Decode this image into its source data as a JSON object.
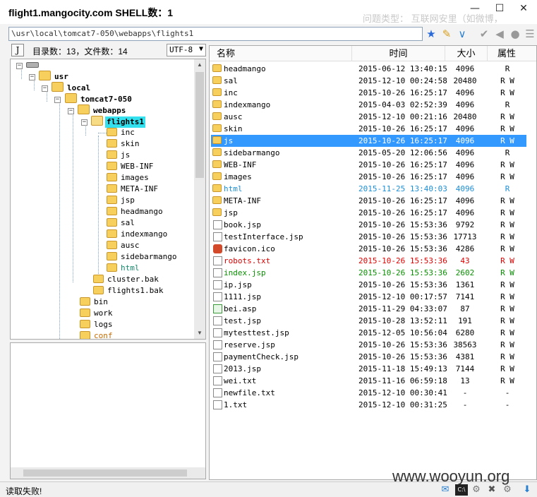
{
  "window": {
    "title": "flight1.mangocity.com SHELL数：1",
    "bg_hint": "问题类型：   互联网安里（如微博，",
    "minimize": "—",
    "maximize": "☐",
    "close": "✕"
  },
  "path": "\\usr\\local\\tomcat7-050\\webapps\\flights1",
  "stats": "目录数：13，文件数：14",
  "encoding": "UTF-8",
  "tree": {
    "usr": "usr",
    "local": "local",
    "tomcat": "tomcat7-050",
    "webapps": "webapps",
    "flights1": "flights1",
    "children": [
      "inc",
      "skin",
      "js",
      "WEB-INF",
      "images",
      "META-INF",
      "jsp",
      "headmango",
      "sal",
      "indexmango",
      "ausc",
      "sidebarmango",
      "html"
    ],
    "webapps_siblings": [
      "cluster.bak",
      "flights1.bak"
    ],
    "tomcat_children": [
      "bin",
      "work",
      "logs",
      "conf"
    ]
  },
  "columns": {
    "name": "名称",
    "time": "时间",
    "size": "大小",
    "attr": "属性"
  },
  "files": [
    {
      "name": "headmango",
      "time": "2015-06-12 13:40:15",
      "size": "4096",
      "attr": "R",
      "icon": "folder-icon"
    },
    {
      "name": "sal",
      "time": "2015-12-10 00:24:58",
      "size": "20480",
      "attr": "R W",
      "icon": "folder-icon"
    },
    {
      "name": "inc",
      "time": "2015-10-26 16:25:17",
      "size": "4096",
      "attr": "R W",
      "icon": "folder-icon"
    },
    {
      "name": "indexmango",
      "time": "2015-04-03 02:52:39",
      "size": "4096",
      "attr": "R",
      "icon": "folder-icon"
    },
    {
      "name": "ausc",
      "time": "2015-12-10 00:21:16",
      "size": "20480",
      "attr": "R W",
      "icon": "folder-icon"
    },
    {
      "name": "skin",
      "time": "2015-10-26 16:25:17",
      "size": "4096",
      "attr": "R W",
      "icon": "folder-icon"
    },
    {
      "name": "js",
      "time": "2015-10-26 16:25:17",
      "size": "4096",
      "attr": "R W",
      "icon": "folder-icon"
    },
    {
      "name": "sidebarmango",
      "time": "2015-05-20 12:06:56",
      "size": "4096",
      "attr": "R",
      "icon": "folder-icon"
    },
    {
      "name": "WEB-INF",
      "time": "2015-10-26 16:25:17",
      "size": "4096",
      "attr": "R W",
      "icon": "folder-icon"
    },
    {
      "name": "images",
      "time": "2015-10-26 16:25:17",
      "size": "4096",
      "attr": "R W",
      "icon": "folder-icon"
    },
    {
      "name": "html",
      "time": "2015-11-25 13:40:03",
      "size": "4096",
      "attr": "R",
      "icon": "folder-icon"
    },
    {
      "name": "META-INF",
      "time": "2015-10-26 16:25:17",
      "size": "4096",
      "attr": "R W",
      "icon": "folder-icon"
    },
    {
      "name": "jsp",
      "time": "2015-10-26 16:25:17",
      "size": "4096",
      "attr": "R W",
      "icon": "folder-icon"
    },
    {
      "name": "book.jsp",
      "time": "2015-10-26 15:53:36",
      "size": "9792",
      "attr": "R W",
      "icon": "jsp-file-icon"
    },
    {
      "name": "testInterface.jsp",
      "time": "2015-10-26 15:53:36",
      "size": "17713",
      "attr": "R W",
      "icon": "jsp-file-icon"
    },
    {
      "name": "favicon.ico",
      "time": "2015-10-26 15:53:36",
      "size": "4286",
      "attr": "R W",
      "icon": "ico-file-icon"
    },
    {
      "name": "robots.txt",
      "time": "2015-10-26 15:53:36",
      "size": "43",
      "attr": "R W",
      "icon": "txt-file-icon"
    },
    {
      "name": "index.jsp",
      "time": "2015-10-26 15:53:36",
      "size": "2602",
      "attr": "R W",
      "icon": "jsp-file-icon"
    },
    {
      "name": "ip.jsp",
      "time": "2015-10-26 15:53:36",
      "size": "1361",
      "attr": "R W",
      "icon": "jsp-file-icon"
    },
    {
      "name": "1111.jsp",
      "time": "2015-12-10 00:17:57",
      "size": "7141",
      "attr": "R W",
      "icon": "jsp-file-icon"
    },
    {
      "name": "bei.asp",
      "time": "2015-11-29 04:33:07",
      "size": "87",
      "attr": "R W",
      "icon": "asp-file-icon"
    },
    {
      "name": "test.jsp",
      "time": "2015-10-28 13:52:11",
      "size": "191",
      "attr": "R W",
      "icon": "jsp-file-icon"
    },
    {
      "name": "mytesttest.jsp",
      "time": "2015-12-05 10:56:04",
      "size": "6280",
      "attr": "R W",
      "icon": "jsp-file-icon"
    },
    {
      "name": "reserve.jsp",
      "time": "2015-10-26 15:53:36",
      "size": "38563",
      "attr": "R W",
      "icon": "jsp-file-icon"
    },
    {
      "name": "paymentCheck.jsp",
      "time": "2015-10-26 15:53:36",
      "size": "4381",
      "attr": "R W",
      "icon": "jsp-file-icon"
    },
    {
      "name": "2013.jsp",
      "time": "2015-11-18 15:49:13",
      "size": "7144",
      "attr": "R W",
      "icon": "jsp-file-icon"
    },
    {
      "name": "wei.txt",
      "time": "2015-11-16 06:59:18",
      "size": "13",
      "attr": "R W",
      "icon": "txt-file-icon"
    },
    {
      "name": "newfile.txt",
      "time": "2015-12-10 00:30:41",
      "size": "-",
      "attr": "-",
      "icon": "txt-file-icon"
    },
    {
      "name": "1.txt",
      "time": "2015-12-10 00:31:25",
      "size": "-",
      "attr": "-",
      "icon": "txt-file-icon"
    }
  ],
  "selected_file": "js",
  "colors": {
    "selection": "#3399ff",
    "html_highlight": "#1c8fd8",
    "robots_highlight": "#e00000",
    "index_highlight": "#089000",
    "tree_selection": "#33e0ee"
  },
  "status": "读取失败!",
  "watermark": "www.wooyun.org"
}
